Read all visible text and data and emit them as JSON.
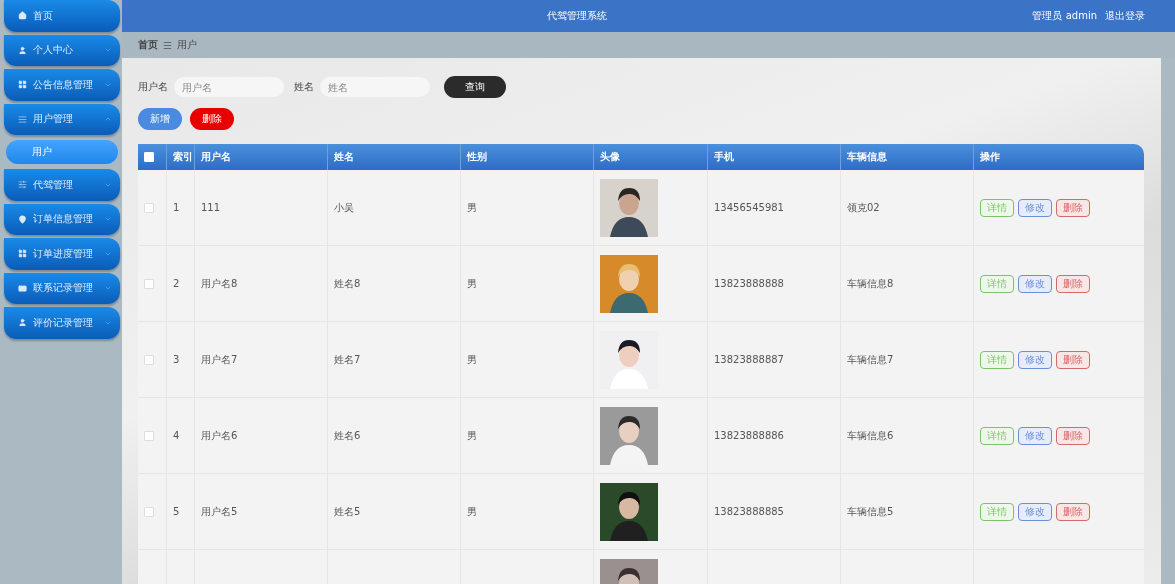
{
  "header": {
    "title": "代驾管理系统",
    "user": "管理员 admin",
    "logout": "退出登录"
  },
  "sidebar": {
    "items": [
      {
        "label": "首页",
        "has_arrow": false
      },
      {
        "label": "个人中心",
        "has_arrow": true,
        "expanded": false
      },
      {
        "label": "公告信息管理",
        "has_arrow": true,
        "expanded": false
      },
      {
        "label": "用户管理",
        "has_arrow": true,
        "expanded": true,
        "children": [
          {
            "label": "用户",
            "selected": true
          }
        ]
      },
      {
        "label": "代驾管理",
        "has_arrow": true,
        "expanded": false
      },
      {
        "label": "订单信息管理",
        "has_arrow": true,
        "expanded": false
      },
      {
        "label": "订单进度管理",
        "has_arrow": true,
        "expanded": false
      },
      {
        "label": "联系记录管理",
        "has_arrow": true,
        "expanded": false
      },
      {
        "label": "评价记录管理",
        "has_arrow": true,
        "expanded": false
      }
    ]
  },
  "breadcrumb": {
    "home": "首页",
    "separator": "☰",
    "current": "用户"
  },
  "search": {
    "fields": [
      {
        "label": "用户名",
        "placeholder": "用户名"
      },
      {
        "label": "姓名",
        "placeholder": "姓名"
      }
    ],
    "button": "查询"
  },
  "actions": {
    "add": "新增",
    "delete": "删除"
  },
  "table": {
    "columns": [
      "索引",
      "用户名",
      "姓名",
      "性别",
      "头像",
      "手机",
      "车辆信息",
      "操作"
    ],
    "select_all_checked": false,
    "rows": [
      {
        "checked": false,
        "index": "1",
        "username": "111",
        "name": "小吴",
        "gender": "男",
        "avatar": {
          "kind": "picture"
        },
        "phone": "13456545981",
        "vehicle": "领克02",
        "buttons": [
          "详情",
          "修改",
          "删除"
        ]
      },
      {
        "checked": false,
        "index": "2",
        "username": "用户名8",
        "name": "姓名8",
        "gender": "男",
        "avatar": {
          "kind": "picture"
        },
        "phone": "13823888888",
        "vehicle": "车辆信息8",
        "buttons": [
          "详情",
          "修改",
          "删除"
        ]
      },
      {
        "checked": false,
        "index": "3",
        "username": "用户名7",
        "name": "姓名7",
        "gender": "男",
        "avatar": {
          "kind": "picture"
        },
        "phone": "13823888887",
        "vehicle": "车辆信息7",
        "buttons": [
          "详情",
          "修改",
          "删除"
        ]
      },
      {
        "checked": false,
        "index": "4",
        "username": "用户名6",
        "name": "姓名6",
        "gender": "男",
        "avatar": {
          "kind": "picture"
        },
        "phone": "13823888886",
        "vehicle": "车辆信息6",
        "buttons": [
          "详情",
          "修改",
          "删除"
        ]
      },
      {
        "checked": false,
        "index": "5",
        "username": "用户名5",
        "name": "姓名5",
        "gender": "男",
        "avatar": {
          "kind": "picture"
        },
        "phone": "13823888885",
        "vehicle": "车辆信息5",
        "buttons": [
          "详情",
          "修改",
          "删除"
        ]
      },
      {
        "avatar": {
          "kind": "picture"
        }
      }
    ]
  }
}
